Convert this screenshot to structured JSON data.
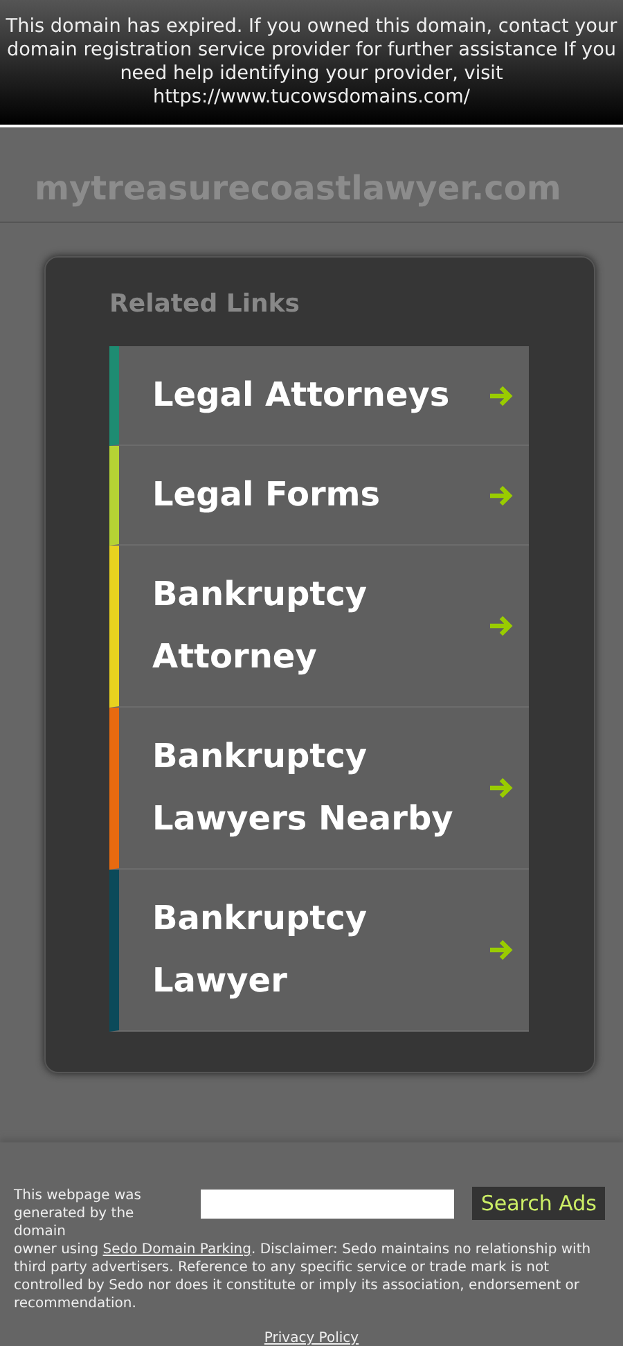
{
  "banner": {
    "message": "This domain has expired. If you owned this domain, contact your domain registration service provider for further assistance If you need help identifying your provider, visit https://www.tucowsdomains.com/"
  },
  "header": {
    "domain": "mytreasurecoastlawyer.com"
  },
  "related_links": {
    "title": "Related Links",
    "items": [
      {
        "label": "Legal Attorneys",
        "color": "#1e8c72"
      },
      {
        "label": "Legal Forms",
        "color": "#b5d334"
      },
      {
        "label": "Bankruptcy Attorney",
        "color": "#e8d21f"
      },
      {
        "label": "Bankruptcy Lawyers Nearby",
        "color": "#e86a10"
      },
      {
        "label": "Bankruptcy Lawyer",
        "color": "#0b4a5a"
      }
    ]
  },
  "footer": {
    "search_button": "Search Ads",
    "text_start": "This webpage was generated by the domain",
    "text_before": "owner using",
    "link": "Sedo Domain Parking",
    "text_after": ". Disclaimer: Sedo maintains no relationship with third party advertisers. Reference to any specific service or trade mark is not controlled by Sedo nor does it constitute or imply its association, endorsement or recommendation.",
    "privacy": "Privacy Policy"
  }
}
